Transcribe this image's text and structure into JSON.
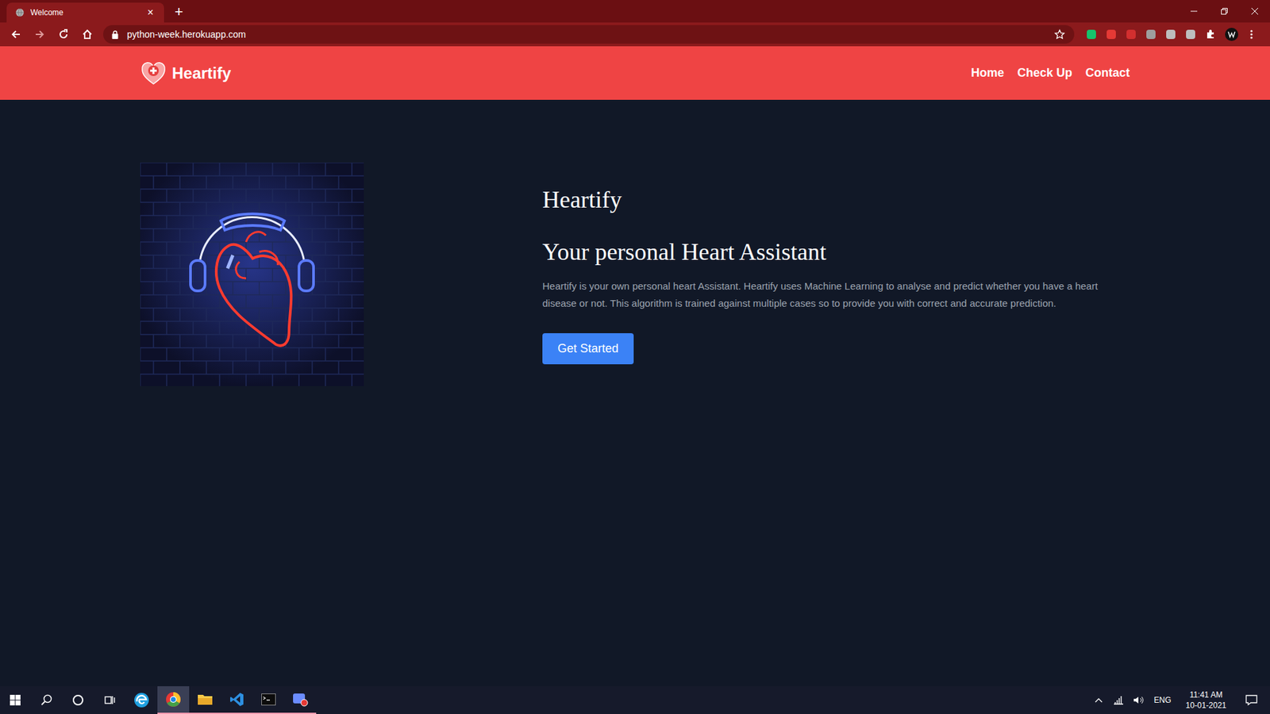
{
  "browser": {
    "tabs": [
      {
        "label": "Welcome",
        "selected": true,
        "close": "×"
      }
    ],
    "new_tab": "+",
    "address": "python-week.herokuapp.com"
  },
  "page": {
    "brand": "Heartify",
    "nav": [
      {
        "label": "Home"
      },
      {
        "label": "Check Up"
      },
      {
        "label": "Contact"
      }
    ],
    "hero": {
      "title": "Heartify",
      "subtitle": "Your personal Heart Assistant",
      "description": "Heartify is your own personal heart Assistant. Heartify uses Machine Learning to analyse and predict whether you have a heart disease or not. This algorithm is trained against multiple cases so to provide you with correct and accurate prediction.",
      "button": "Get Started"
    }
  },
  "taskbar": {
    "language": "ENG",
    "time": "11:41 AM",
    "date": "10-01-2021"
  }
}
